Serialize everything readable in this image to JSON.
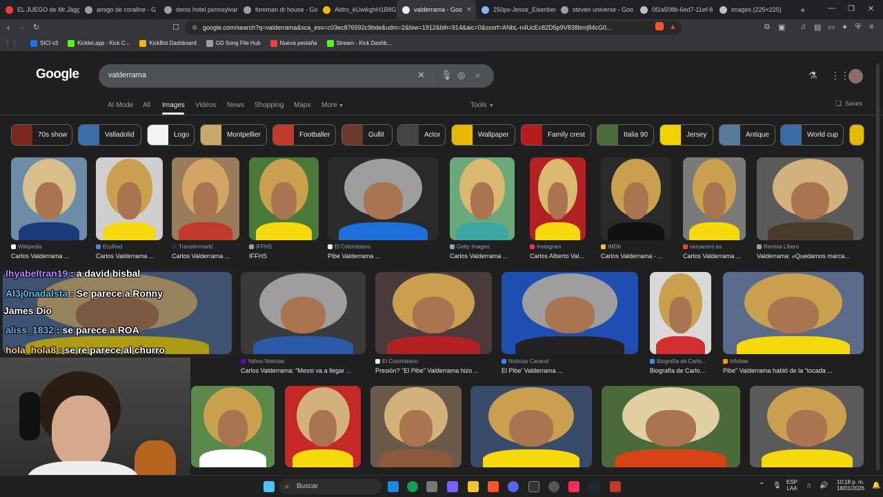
{
  "browser": {
    "tabs": [
      {
        "label": "EL JUEGO de Mr.Jägger"
      },
      {
        "label": "amigo de coraline - G"
      },
      {
        "label": "denis hotel pennsylvan"
      },
      {
        "label": "foreman dr house - Go"
      },
      {
        "label": "Aldro_kUwikghH1B8G"
      },
      {
        "label": "valderrama - Goo"
      },
      {
        "label": "250px-Jesse_Eisenberg"
      },
      {
        "label": "steven universe - Goo"
      },
      {
        "label": "0f2a508b-6ed7-11ef-8"
      },
      {
        "label": "images (225×225)"
      }
    ],
    "url": "google.com/search?q=valderrama&sca_esv=c03ec876592c9bde&udm=2&biw=1912&bih=914&aic=0&sxsrf=ANbL-n4UcEc82D5p9V838bm|84cG0...",
    "bookmarks": [
      {
        "label": "SICI v3",
        "color": "#1a73e8"
      },
      {
        "label": "Kicklet.app - Kick C...",
        "color": "#53fc18"
      },
      {
        "label": "KickBot Dashboard",
        "color": "#f4b400"
      },
      {
        "label": "GD Song File Hub",
        "color": "#9aa0a6"
      },
      {
        "label": "Nueva pestaña",
        "color": "#ea4335"
      },
      {
        "label": "Stream - Kick Dashb...",
        "color": "#53fc18"
      }
    ]
  },
  "google": {
    "logo": "Google",
    "query": "valderrama",
    "nav": [
      "AI Mode",
      "All",
      "Images",
      "Videos",
      "News",
      "Shopping",
      "Maps",
      "More",
      "Tools"
    ],
    "saves": "Saves",
    "chips": [
      "70s show",
      "Valladolid",
      "Logo",
      "Montpellier",
      "Footballer",
      "Gullit",
      "Actor",
      "Wallpaper",
      "Family crest",
      "Italia 90",
      "Jersey",
      "Antique",
      "World cup"
    ]
  },
  "results_row1": [
    {
      "source": "Wikipedia",
      "caption": "Carlos Valderrama ...",
      "src_color": "#ffffff"
    },
    {
      "source": "EcuRed",
      "caption": "Carlos Valderrama ...",
      "src_color": "#4285f4"
    },
    {
      "source": "Transfermarkt",
      "caption": "Carlos Valderrama ...",
      "src_color": "#1a3151"
    },
    {
      "source": "IFFHS",
      "caption": "IFFHS",
      "src_color": "#9aa0a6"
    },
    {
      "source": "El Colombiano",
      "caption": "Pibe Valderrama ...",
      "src_color": "#e8eaed"
    },
    {
      "source": "Getty Images",
      "caption": "Carlos Valderrama ...",
      "src_color": "#9aa0a6"
    },
    {
      "source": "Instagram",
      "caption": "Carlos Alberto Val...",
      "src_color": "#e1306c"
    },
    {
      "source": "IMDb",
      "caption": "Carlos Valderrama - ...",
      "src_color": "#f5c518"
    },
    {
      "source": "ceroacero.es",
      "caption": "Carlos Valderrama ...",
      "src_color": "#ea4335"
    },
    {
      "source": "Revista Libero",
      "caption": "Valderrama: «Quedamos marca...",
      "src_color": "#9aa0a6"
    }
  ],
  "results_row2": [
    {
      "source": "Yahoo Noticias",
      "caption": "Carlos Valderrama: \"Messi va a llegar ...",
      "src_color": "#6001d2"
    },
    {
      "source": "El Colombiano",
      "caption": "Presión? \"El Pibe\" Valderrama hizo ...",
      "src_color": "#e8eaed"
    },
    {
      "source": "Noticias Caracol",
      "caption": "El Pibe' Valderrama ...",
      "src_color": "#4285f4"
    },
    {
      "source": "Biografía de Carlo...",
      "caption": "Biografía de Carlo...",
      "src_color": "#4285f4"
    },
    {
      "source": "Infobae",
      "caption": "Pibe\" Valderrama habló de la \"tocada ...",
      "src_color": "#f29900"
    }
  ],
  "chat": [
    {
      "user": "lhyabeltran19",
      "message": " : a david bisbal",
      "color": "#b388ff"
    },
    {
      "user": "Al3j0nadalsta",
      "message": " : Se parece a Ronny",
      "color": "#4fc3f7"
    },
    {
      "user": "",
      "message": "James Dio",
      "color": "#ffffff"
    },
    {
      "user": "aliss_1832",
      "message": " : se parece a ROA",
      "color": "#64b5f6"
    },
    {
      "user": "hola_hola8",
      "message": " : se re parece al churro",
      "color": "#ffd54f"
    }
  ],
  "taskbar": {
    "search_placeholder": "Buscar",
    "lang": "ESP",
    "lang2": "LAA",
    "time": "10:18 p. m.",
    "date": "18/01/2026"
  }
}
